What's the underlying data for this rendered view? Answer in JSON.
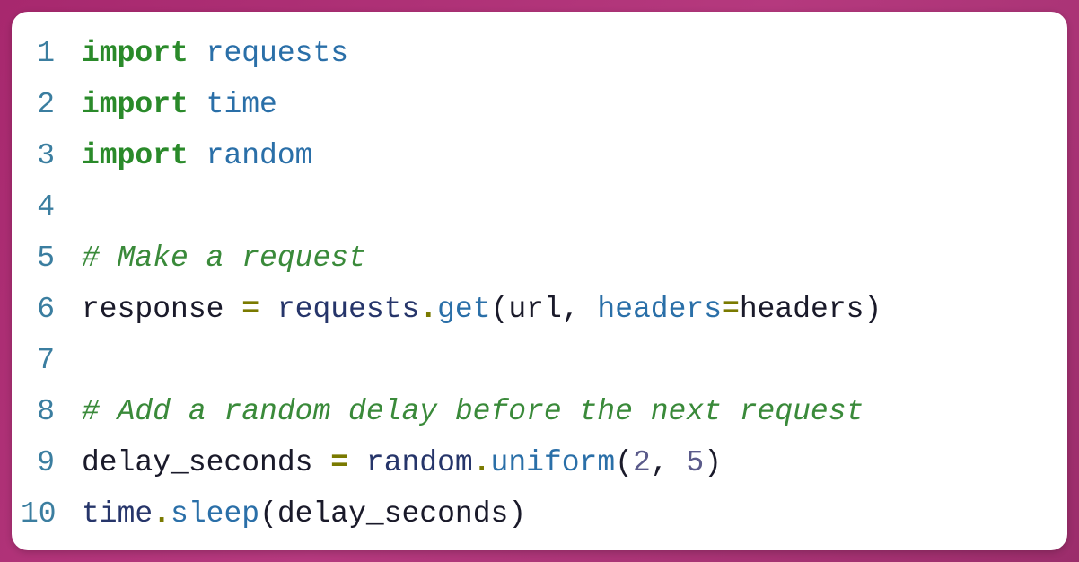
{
  "code": {
    "lines": [
      {
        "n": "1",
        "tokens": [
          {
            "t": "import",
            "c": "kw"
          },
          {
            "t": " "
          },
          {
            "t": "requests",
            "c": "mod"
          }
        ]
      },
      {
        "n": "2",
        "tokens": [
          {
            "t": "import",
            "c": "kw"
          },
          {
            "t": " "
          },
          {
            "t": "time",
            "c": "mod"
          }
        ]
      },
      {
        "n": "3",
        "tokens": [
          {
            "t": "import",
            "c": "kw"
          },
          {
            "t": " "
          },
          {
            "t": "random",
            "c": "mod"
          }
        ]
      },
      {
        "n": "4",
        "tokens": []
      },
      {
        "n": "5",
        "tokens": [
          {
            "t": "# Make a request",
            "c": "comment"
          }
        ]
      },
      {
        "n": "6",
        "tokens": [
          {
            "t": "response",
            "c": "var"
          },
          {
            "t": " "
          },
          {
            "t": "=",
            "c": "eq"
          },
          {
            "t": " "
          },
          {
            "t": "requests",
            "c": "obj"
          },
          {
            "t": ".",
            "c": "dot"
          },
          {
            "t": "get",
            "c": "fn"
          },
          {
            "t": "(",
            "c": "paren"
          },
          {
            "t": "url",
            "c": "param"
          },
          {
            "t": ", ",
            "c": "paren"
          },
          {
            "t": "headers",
            "c": "kwarg"
          },
          {
            "t": "=",
            "c": "eq"
          },
          {
            "t": "headers",
            "c": "param"
          },
          {
            "t": ")",
            "c": "paren"
          }
        ]
      },
      {
        "n": "7",
        "tokens": []
      },
      {
        "n": "8",
        "tokens": [
          {
            "t": "# Add a random delay before the next request",
            "c": "comment"
          }
        ]
      },
      {
        "n": "9",
        "tokens": [
          {
            "t": "delay_seconds",
            "c": "var"
          },
          {
            "t": " "
          },
          {
            "t": "=",
            "c": "eq"
          },
          {
            "t": " "
          },
          {
            "t": "random",
            "c": "obj"
          },
          {
            "t": ".",
            "c": "dot"
          },
          {
            "t": "uniform",
            "c": "fn"
          },
          {
            "t": "(",
            "c": "paren"
          },
          {
            "t": "2",
            "c": "num"
          },
          {
            "t": ", ",
            "c": "paren"
          },
          {
            "t": "5",
            "c": "num"
          },
          {
            "t": ")",
            "c": "paren"
          }
        ]
      },
      {
        "n": "10",
        "tokens": [
          {
            "t": "time",
            "c": "obj"
          },
          {
            "t": ".",
            "c": "dot"
          },
          {
            "t": "sleep",
            "c": "fn"
          },
          {
            "t": "(",
            "c": "paren"
          },
          {
            "t": "delay_seconds",
            "c": "param"
          },
          {
            "t": ")",
            "c": "paren"
          }
        ]
      }
    ]
  }
}
